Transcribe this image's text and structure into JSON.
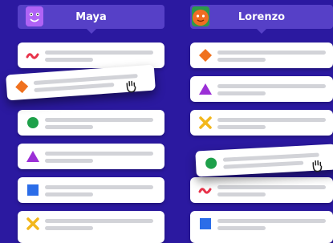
{
  "columns": [
    {
      "name": "Maya",
      "avatar": "purple-monster-avatar",
      "avatar_color": "#9b3df0"
    },
    {
      "name": "Lorenzo",
      "avatar": "orange-monster-avatar",
      "avatar_color": "#f06d22"
    }
  ],
  "icons": {
    "squiggle": "red-squiggle-icon",
    "diamond": "orange-diamond-icon",
    "circle": "green-circle-icon",
    "triangle": "purple-triangle-icon",
    "square": "blue-square-icon",
    "cross": "yellow-x-icon"
  },
  "colors": {
    "background": "#2b19a0",
    "header": "#5640c7",
    "red": "#e8334a",
    "orange": "#f0711e",
    "green": "#1ea04a",
    "purple": "#9b2fd6",
    "blue": "#2b6de8",
    "yellow": "#f2b71c"
  },
  "cursor": "grab-hand-cursor"
}
